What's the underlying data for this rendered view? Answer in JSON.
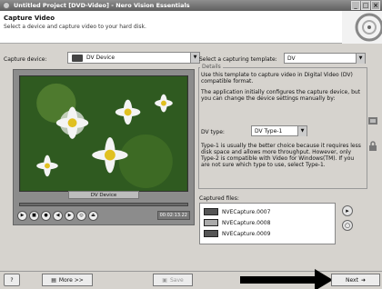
{
  "window": {
    "title": "Untitled Project [DVD-Video] - Nero Vision Essentials"
  },
  "header": {
    "title": "Capture Video",
    "subtitle": "Select a device and capture video to your hard disk."
  },
  "capture_device": {
    "label": "Capture device:",
    "value": "DV Device"
  },
  "video": {
    "caption": "DV Device",
    "timecode": "00:02:13.22"
  },
  "template": {
    "label": "Select a capturing template:",
    "value": "DV"
  },
  "details": {
    "legend": "Details",
    "line1": "Use this template to capture video in Digital Video (DV) compatible format.",
    "line2": "The application initially configures the capture device, but you can change the device settings manually by:",
    "dv_type_label": "DV type:",
    "dv_type_value": "DV Type-1",
    "line3": "Type-1 is usually the better choice because it requires less disk space and allows more throughput. However, only Type-2 is compatible with Video for Windows(TM). If you are not sure which type to use, select Type-1."
  },
  "captured": {
    "label": "Captured files:",
    "files": [
      "NVECapture.0007",
      "NVECapture.0008",
      "NVECapture.0009"
    ]
  },
  "buttons": {
    "more": "More >>",
    "save": "Save",
    "next": "Next"
  },
  "icons": {
    "help": "help-icon",
    "save": "save-icon",
    "next": "next-arrow-icon"
  }
}
